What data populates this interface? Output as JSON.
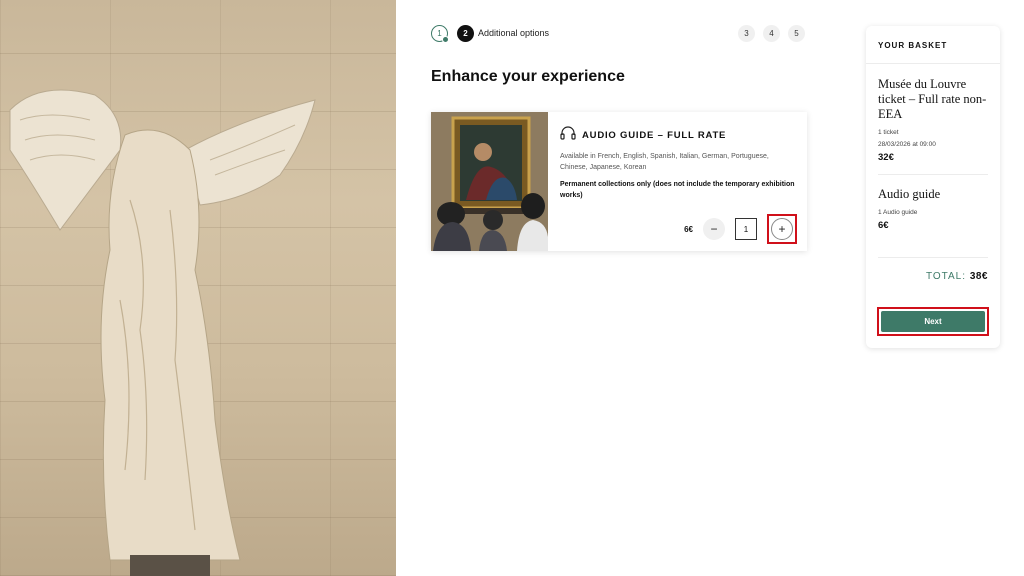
{
  "stepper": {
    "steps": [
      "1",
      "2",
      "3",
      "4",
      "5"
    ],
    "current_label": "Additional options"
  },
  "page_title": "Enhance your experience",
  "product": {
    "title": "AUDIO GUIDE – FULL RATE",
    "languages": "Available in French, English, Spanish, Italian, German, Portuguese, Chinese, Japanese, Korean",
    "note": "Permanent collections only (does not include the temporary exhibition works)",
    "price": "6€",
    "quantity": "1",
    "minus_label": "−",
    "plus_label": "+",
    "icon": "headphones-icon"
  },
  "basket": {
    "title": "YOUR BASKET",
    "items": [
      {
        "name": "Musée du Louvre ticket – Full rate non-EEA",
        "detail_1": "1 ticket",
        "detail_2": "28/03/2026 at 09:00",
        "price": "32€"
      },
      {
        "name": "Audio guide",
        "detail_1": "1 Audio guide",
        "price": "6€"
      }
    ],
    "total_label": "TOTAL:",
    "total_value": "38€",
    "next_label": "Next"
  },
  "colors": {
    "accent": "#3e7a68",
    "highlight": "#d0101a",
    "step_active": "#111111"
  }
}
